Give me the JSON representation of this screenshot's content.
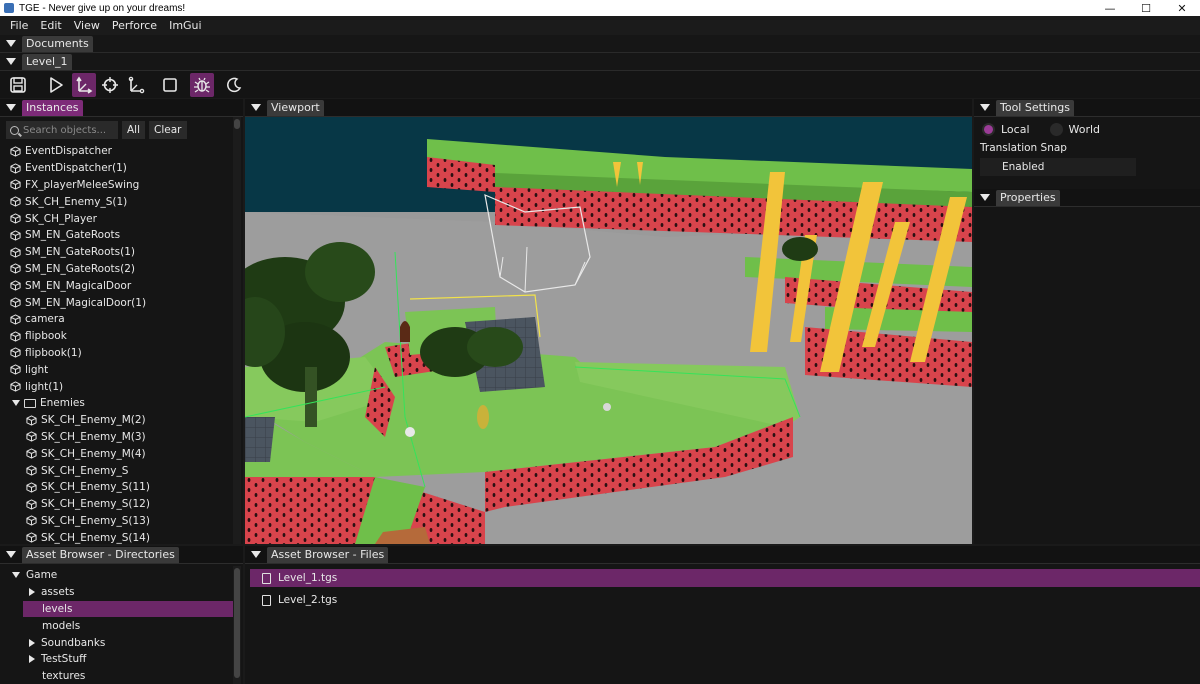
{
  "window": {
    "title": "TGE - Never give up on your dreams!"
  },
  "menubar": {
    "items": [
      "File",
      "Edit",
      "View",
      "Perforce",
      "ImGui"
    ]
  },
  "documents_tab": "Documents",
  "level_tab": "Level_1",
  "toolbar": {
    "buttons": [
      {
        "icon": "save-icon",
        "active": false
      },
      {
        "icon": "play-icon",
        "active": false
      },
      {
        "icon": "translate-gizmo-icon",
        "active": true
      },
      {
        "icon": "rotate-gizmo-icon",
        "active": false
      },
      {
        "icon": "scale-gizmo-icon",
        "active": false
      },
      {
        "icon": "square-icon",
        "active": false
      },
      {
        "icon": "bug-icon",
        "active": true
      },
      {
        "icon": "moon-icon",
        "active": false
      }
    ]
  },
  "instances": {
    "tab": "Instances",
    "search_placeholder": "Search objects...",
    "all_label": "All",
    "clear_label": "Clear",
    "items": [
      "EventDispatcher",
      "EventDispatcher(1)",
      "FX_playerMeleeSwing",
      "SK_CH_Enemy_S(1)",
      "SK_CH_Player",
      "SM_EN_GateRoots",
      "SM_EN_GateRoots(1)",
      "SM_EN_GateRoots(2)",
      "SM_EN_MagicalDoor",
      "SM_EN_MagicalDoor(1)",
      "camera",
      "flipbook",
      "flipbook(1)",
      "light",
      "light(1)"
    ],
    "folder": "Enemies",
    "folder_items": [
      "SK_CH_Enemy_M(2)",
      "SK_CH_Enemy_M(3)",
      "SK_CH_Enemy_M(4)",
      "SK_CH_Enemy_S",
      "SK_CH_Enemy_S(11)",
      "SK_CH_Enemy_S(12)",
      "SK_CH_Enemy_S(13)",
      "SK_CH_Enemy_S(14)"
    ]
  },
  "viewport": {
    "tab": "Viewport"
  },
  "tool_settings": {
    "tab": "Tool Settings",
    "local_label": "Local",
    "world_label": "World",
    "selected_space": "Local",
    "translation_snap_label": "Translation Snap",
    "enabled_label": "Enabled"
  },
  "properties": {
    "tab": "Properties"
  },
  "asset_dirs": {
    "tab": "Asset Browser - Directories",
    "root": "Game",
    "children": [
      {
        "label": "assets",
        "expandable": true,
        "selected": false
      },
      {
        "label": "levels",
        "expandable": false,
        "selected": true
      },
      {
        "label": "models",
        "expandable": false,
        "selected": false
      },
      {
        "label": "Soundbanks",
        "expandable": true,
        "selected": false
      },
      {
        "label": "TestStuff",
        "expandable": true,
        "selected": false
      },
      {
        "label": "textures",
        "expandable": false,
        "selected": false
      }
    ]
  },
  "asset_files": {
    "tab": "Asset Browser - Files",
    "files": [
      {
        "name": "Level_1.tgs",
        "selected": true
      },
      {
        "name": "Level_2.tgs",
        "selected": false
      }
    ]
  },
  "colors": {
    "accent": "#7d2b78",
    "selection": "#6c2768",
    "background": "#151515",
    "sky": "#073746",
    "grass": "#6fbf4a",
    "watermelon": "#d8444c",
    "pillar": "#f2c43a"
  }
}
